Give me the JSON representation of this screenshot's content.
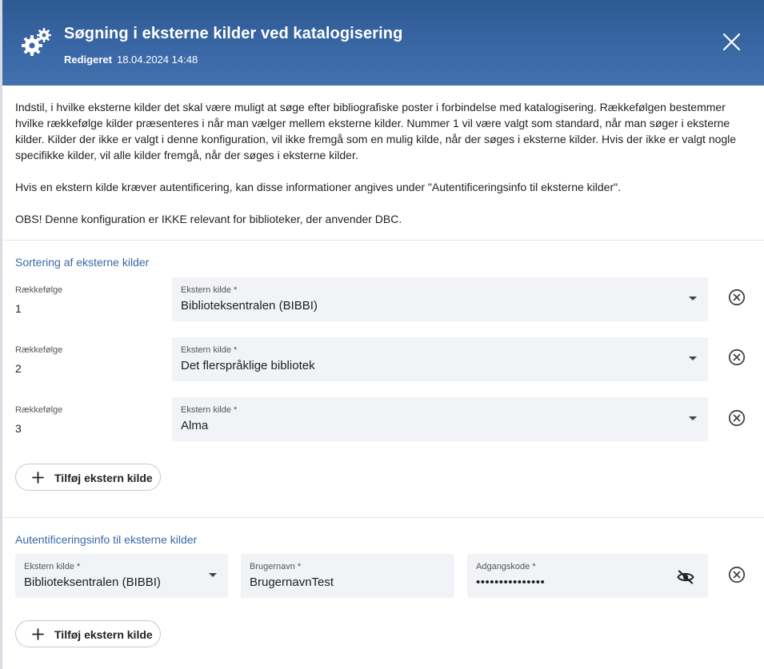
{
  "header": {
    "title": "Søgning i eksterne kilder ved katalogisering",
    "edited_label": "Redigeret",
    "edited_timestamp": "18.04.2024 14:48"
  },
  "intro": {
    "paragraph1": "Indstil, i hvilke eksterne kilder det skal være muligt at søge efter bibliografiske poster i forbindelse med katalogisering. Rækkefølgen bestemmer hvilke rækkefølge kilder præsenteres i når man vælger mellem eksterne kilder. Nummer 1 vil være valgt som standard, når man søger i eksterne kilder. Kilder der ikke er valgt i denne konfiguration, vil ikke fremgå som en mulig kilde, når der søges i eksterne kilder. Hvis der ikke er valgt nogle specifikke kilder, vil alle kilder fremgå, når der søges i eksterne kilder.",
    "paragraph2": "Hvis en ekstern kilde kræver autentificering, kan disse informationer angives under \"Autentificeringsinfo til eksterne kilder\".",
    "paragraph3": "OBS! Denne konfiguration er IKKE relevant for biblioteker, der anvender DBC."
  },
  "sorting": {
    "title": "Sortering af eksterne kilder",
    "order_label": "Rækkefølge",
    "source_label": "Ekstern kilde *",
    "rows": [
      {
        "order": "1",
        "source": "Biblioteksentralen (BIBBI)"
      },
      {
        "order": "2",
        "source": "Det flerspråklige bibliotek"
      },
      {
        "order": "3",
        "source": "Alma"
      }
    ],
    "add_button": "Tilføj ekstern kilde"
  },
  "auth": {
    "title": "Autentificeringsinfo til eksterne kilder",
    "source_label": "Ekstern kilde *",
    "source_value": "Biblioteksentralen (BIBBI)",
    "username_label": "Brugernavn *",
    "username_value": "BrugernavnTest",
    "password_label": "Adgangskode *",
    "password_value": "•••••••••••••••",
    "add_button": "Tilføj ekstern kilde"
  },
  "colors": {
    "header_bg": "#3a68a6",
    "accent": "#3a67a5",
    "field_bg": "#f1f3f6"
  },
  "icons": {
    "header": "gears-icon",
    "close": "close-icon",
    "remove": "circle-x-icon",
    "dropdown": "caret-down-icon",
    "add": "plus-icon",
    "password_visibility": "eye-slash-icon"
  }
}
